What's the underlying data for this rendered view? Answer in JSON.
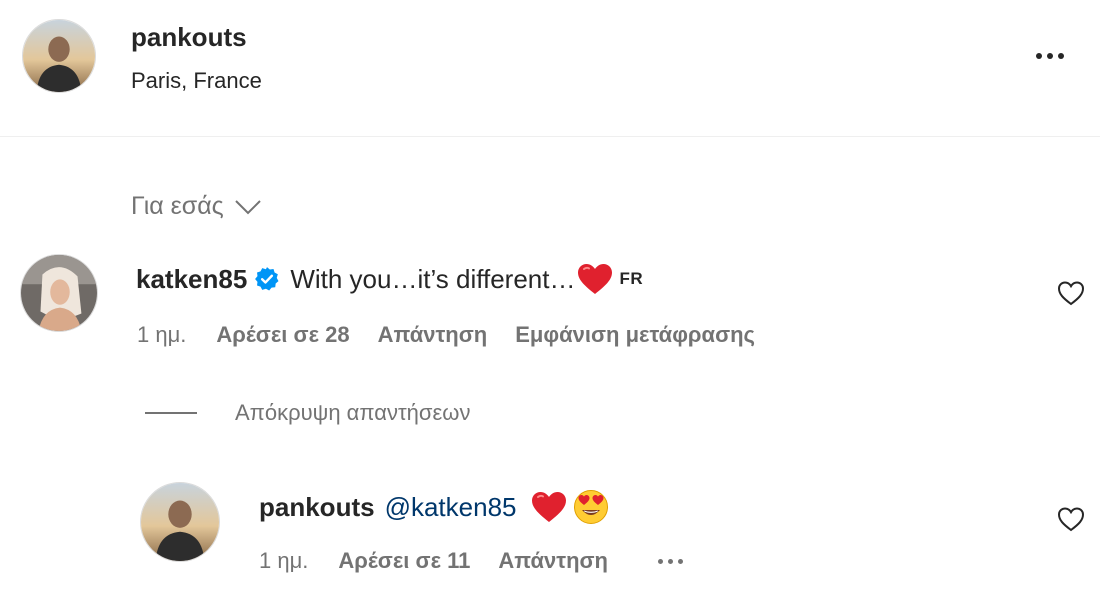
{
  "post": {
    "username": "pankouts",
    "location": "Paris, France"
  },
  "filter": {
    "label": "Για εσάς"
  },
  "comment": {
    "username": "katken85",
    "text": "With you…it’s different…",
    "tag": "FR",
    "time": "1 ημ.",
    "likes": "Αρέσει σε 28",
    "reply": "Απάντηση",
    "translate": "Εμφάνιση μετάφρασης"
  },
  "replies_toggle": {
    "label": "Απόκρυψη απαντήσεων"
  },
  "reply": {
    "username": "pankouts",
    "mention": "@katken85",
    "time": "1 ημ.",
    "likes": "Αρέσει σε 11",
    "reply": "Απάντηση"
  },
  "colors": {
    "text": "#262626",
    "muted": "#737373",
    "verified": "#0095f6",
    "heart_emoji": "#e0212e",
    "mention": "#00376b"
  },
  "icons": [
    "more-options-icon",
    "chevron-down-icon",
    "verified-badge-icon",
    "heart-emoji-icon",
    "heart-eyes-emoji-icon",
    "like-heart-icon"
  ]
}
